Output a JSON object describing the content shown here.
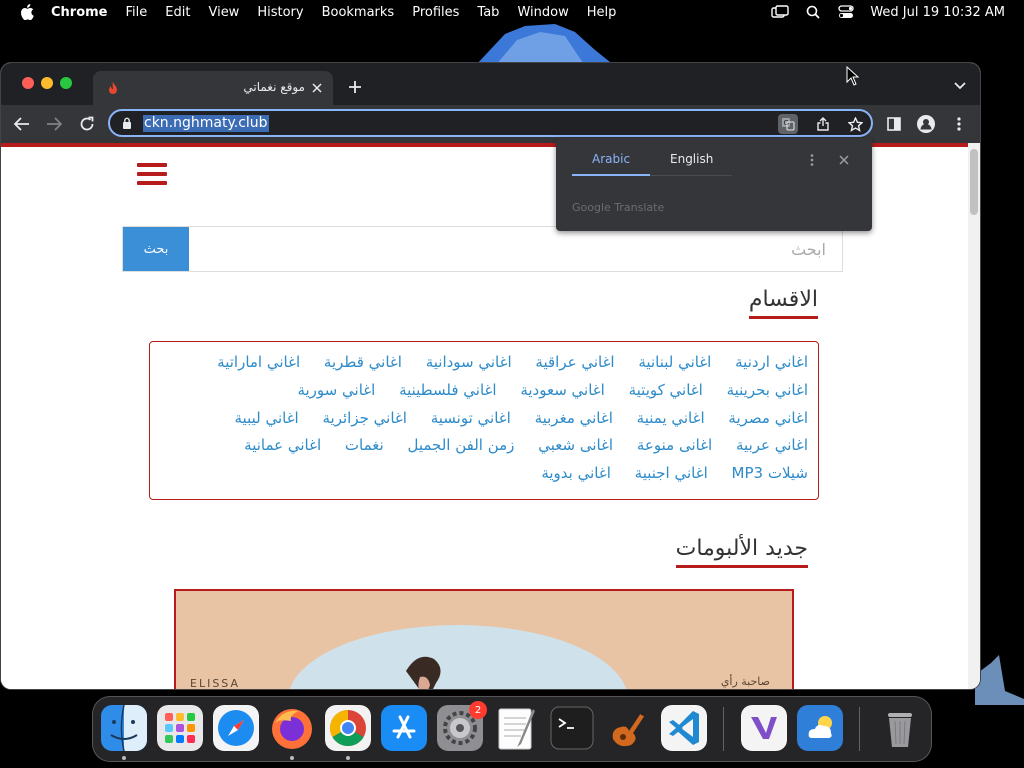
{
  "menubar": {
    "app_name": "Chrome",
    "items": [
      "File",
      "Edit",
      "View",
      "History",
      "Bookmarks",
      "Profiles",
      "Tab",
      "Window",
      "Help"
    ],
    "clock": "Wed Jul 19  10:32 AM"
  },
  "browser": {
    "tab_title": "موقع نغماتي",
    "url": "ckn.nghmaty.club"
  },
  "page": {
    "search": {
      "button_label": "بحث",
      "placeholder": "ابحث"
    },
    "categories_title": "الاقسام",
    "categories_rows": [
      [
        "اغاني اردنية",
        "اغاني لبنانية",
        "اغاني عراقية",
        "اغاني سودانية",
        "اغاني قطرية",
        "اغاني اماراتية"
      ],
      [
        "اغاني بحرينية",
        "اغاني كويتية",
        "اغاني سعودية",
        "اغاني فلسطينية",
        "اغاني سورية"
      ],
      [
        "اغاني مصرية",
        "اغاني يمنية",
        "اغاني مغربية",
        "اغاني تونسية",
        "اغاني جزائرية",
        "اغاني ليبية"
      ],
      [
        "اغاني عربية",
        "اغانى منوعة",
        "اغانى شعبي",
        "زمن الفن الجميل",
        "نغمات",
        "اغاني عمانية"
      ],
      [
        "شيلات MP3",
        "اغاني اجنبية",
        "اغاني بدوية"
      ]
    ],
    "albums_title": "جديد الألبومات",
    "album_left_text": "ELISSA",
    "album_right_text": "صاحبة رأي"
  },
  "translate_popup": {
    "tab_active": "Arabic",
    "tab_inactive": "English",
    "brand": "Google Translate"
  },
  "dock": {
    "apps": [
      "Finder",
      "Launchpad",
      "Safari",
      "Firefox",
      "Chrome",
      "App Store",
      "System Settings",
      "TextEdit",
      "Terminal",
      "GarageBand",
      "Visual Studio Code",
      "Visual Studio",
      "Weather",
      "Trash"
    ],
    "settings_badge": "2"
  }
}
